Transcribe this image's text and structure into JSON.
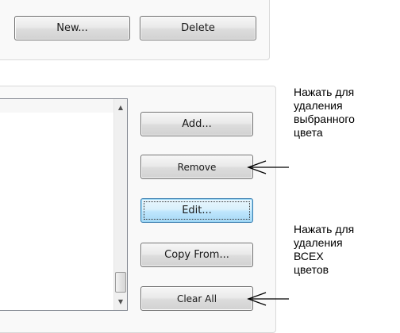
{
  "top_group": {
    "new_button": "New...",
    "delete_button": "Delete"
  },
  "list_panel": {
    "scroll_up_glyph": "▲",
    "scroll_down_glyph": "▼"
  },
  "side_buttons": {
    "add": "Add...",
    "remove": "Remove",
    "edit": "Edit...",
    "copy_from": "Copy From...",
    "clear_all": "Clear All"
  },
  "annotations": {
    "remove_note": "Нажать для\nудаления\nвыбранного\nцвета",
    "clear_all_note": "Нажать для\nудаления\nВСЕХ\nцветов"
  },
  "colors": {
    "arrow": "#000000",
    "focused_button_border": "#3c7fb1"
  }
}
